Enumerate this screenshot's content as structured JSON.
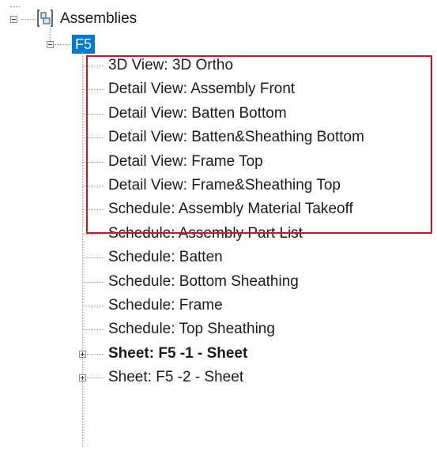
{
  "tree": {
    "root": {
      "label": "Assemblies",
      "icon": "assembly-icon"
    },
    "assembly": {
      "label": "F5"
    },
    "children": [
      {
        "label": "3D View: 3D Ortho",
        "bold": false,
        "expander": "none"
      },
      {
        "label": "Detail View: Assembly Front",
        "bold": false,
        "expander": "none"
      },
      {
        "label": "Detail View: Batten Bottom",
        "bold": false,
        "expander": "none"
      },
      {
        "label": "Detail View: Batten&Sheathing Bottom",
        "bold": false,
        "expander": "none"
      },
      {
        "label": "Detail View: Frame Top",
        "bold": false,
        "expander": "none"
      },
      {
        "label": "Detail View: Frame&Sheathing Top",
        "bold": false,
        "expander": "none"
      },
      {
        "label": "Schedule: Assembly Material Takeoff",
        "bold": false,
        "expander": "none"
      },
      {
        "label": "Schedule: Assembly Part List",
        "bold": false,
        "expander": "none"
      },
      {
        "label": "Schedule: Batten",
        "bold": false,
        "expander": "none"
      },
      {
        "label": "Schedule: Bottom Sheathing",
        "bold": false,
        "expander": "none"
      },
      {
        "label": "Schedule: Frame",
        "bold": false,
        "expander": "none"
      },
      {
        "label": "Schedule: Top Sheathing",
        "bold": false,
        "expander": "none"
      },
      {
        "label": "Sheet: F5 -1 - Sheet",
        "bold": true,
        "expander": "collapsed"
      },
      {
        "label": "Sheet: F5 -2 - Sheet",
        "bold": false,
        "expander": "collapsed"
      }
    ]
  },
  "colors": {
    "selection": "#0078d7",
    "highlight_border": "#e0111f",
    "connector": "#9a9a9a"
  }
}
